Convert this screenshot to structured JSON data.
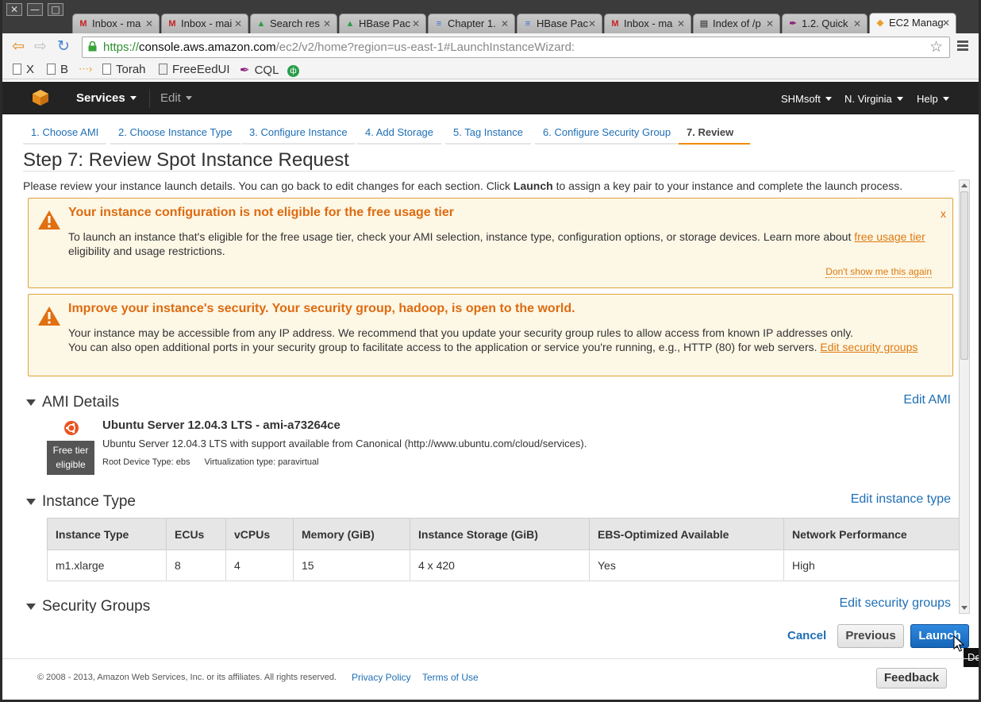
{
  "window": {
    "close_glyph": "✕",
    "minimize_glyph": "—",
    "maximize_glyph": "□"
  },
  "tabs": [
    {
      "label": "Inbox - ma",
      "icon": "gmail-icon",
      "fav": "M",
      "color": "#c5221f"
    },
    {
      "label": "Inbox - mai",
      "icon": "gmail-icon",
      "fav": "M",
      "color": "#c5221f"
    },
    {
      "label": "Search res",
      "icon": "drive-icon",
      "fav": "▲",
      "color": "#2a9d4a"
    },
    {
      "label": "HBase Pac",
      "icon": "drive-icon",
      "fav": "▲",
      "color": "#2a9d4a"
    },
    {
      "label": "Chapter 1.",
      "icon": "docs-icon",
      "fav": "≡",
      "color": "#3b6fd6"
    },
    {
      "label": "HBase Pac",
      "icon": "docs-icon",
      "fav": "≡",
      "color": "#3b6fd6"
    },
    {
      "label": "Inbox - ma",
      "icon": "gmail-icon",
      "fav": "M",
      "color": "#c5221f"
    },
    {
      "label": "Index of /p",
      "icon": "page-icon",
      "fav": "▤",
      "color": "#555555"
    },
    {
      "label": "1.2. Quick",
      "icon": "feather-icon",
      "fav": "✒",
      "color": "#8a1f7a"
    },
    {
      "label": "EC2 Manag",
      "icon": "aws-icon",
      "fav": "◆",
      "color": "#e9a02b"
    }
  ],
  "browser": {
    "url_scheme": "https://",
    "url_host": "console.aws.amazon.com",
    "url_path": "/ec2/v2/home?region=us-east-1#LaunchInstanceWizard:",
    "bookmarks": [
      "X",
      "B",
      "",
      "Torah",
      "FreeEedUI",
      "CQL",
      ""
    ]
  },
  "aws_header": {
    "services": "Services",
    "edit": "Edit",
    "account": "SHMsoft",
    "region": "N. Virginia",
    "help": "Help"
  },
  "wizard_steps": [
    "1. Choose AMI",
    "2. Choose Instance Type",
    "3. Configure Instance",
    "4. Add Storage",
    "5. Tag Instance",
    "6. Configure Security Group",
    "7. Review"
  ],
  "page": {
    "title": "Step 7: Review Spot Instance Request",
    "intro_before": "Please review your instance launch details. You can go back to edit changes for each section. Click ",
    "intro_bold": "Launch",
    "intro_after": " to assign a key pair to your instance and complete the launch process."
  },
  "alert_free_tier": {
    "heading": "Your instance configuration is not eligible for the free usage tier",
    "close": "x",
    "body_before": "To launch an instance that's eligible for the free usage tier, check your AMI selection, instance type, configuration options, or storage devices. Learn more about ",
    "link": "free usage tier",
    "body_after": " eligibility and usage restrictions.",
    "dont_show": "Don't show me this again"
  },
  "alert_security": {
    "heading": "Improve your instance's security. Your security group, hadoop, is open to the world.",
    "line1": "Your instance may be accessible from any IP address. We recommend that you update your security group rules to allow access from known IP addresses only.",
    "line2_before": "You can also open additional ports in your security group to facilitate access to the application or service you're running, e.g., HTTP (80) for web servers. ",
    "link": "Edit security groups"
  },
  "ami": {
    "section_title": "AMI Details",
    "edit_link": "Edit AMI",
    "badge_line1": "Free tier",
    "badge_line2": "eligible",
    "name": "Ubuntu Server 12.04.3 LTS - ami-a73264ce",
    "description": "Ubuntu Server 12.04.3 LTS with support available from Canonical (http://www.ubuntu.com/cloud/services).",
    "root_device": "Root Device Type: ebs",
    "virtualization": "Virtualization type: paravirtual"
  },
  "instance_type": {
    "section_title": "Instance Type",
    "edit_link": "Edit instance type",
    "columns": [
      "Instance Type",
      "ECUs",
      "vCPUs",
      "Memory (GiB)",
      "Instance Storage (GiB)",
      "EBS-Optimized Available",
      "Network Performance"
    ],
    "rows": [
      [
        "m1.xlarge",
        "8",
        "4",
        "15",
        "4 x 420",
        "Yes",
        "High"
      ]
    ]
  },
  "security_groups": {
    "section_title": "Security Groups",
    "edit_link": "Edit security groups"
  },
  "actions": {
    "cancel": "Cancel",
    "previous": "Previous",
    "launch": "Launch",
    "tooltip": "Del"
  },
  "footer": {
    "copyright": "© 2008 - 2013, Amazon Web Services, Inc. or its affiliates. All rights reserved.",
    "privacy": "Privacy Policy",
    "terms": "Terms of Use",
    "feedback": "Feedback"
  },
  "colors": {
    "aws_orange": "#f08c00",
    "link_blue": "#1f6fb5",
    "alert_orange": "#dd6b10",
    "launch_blue": "#1565b8"
  }
}
